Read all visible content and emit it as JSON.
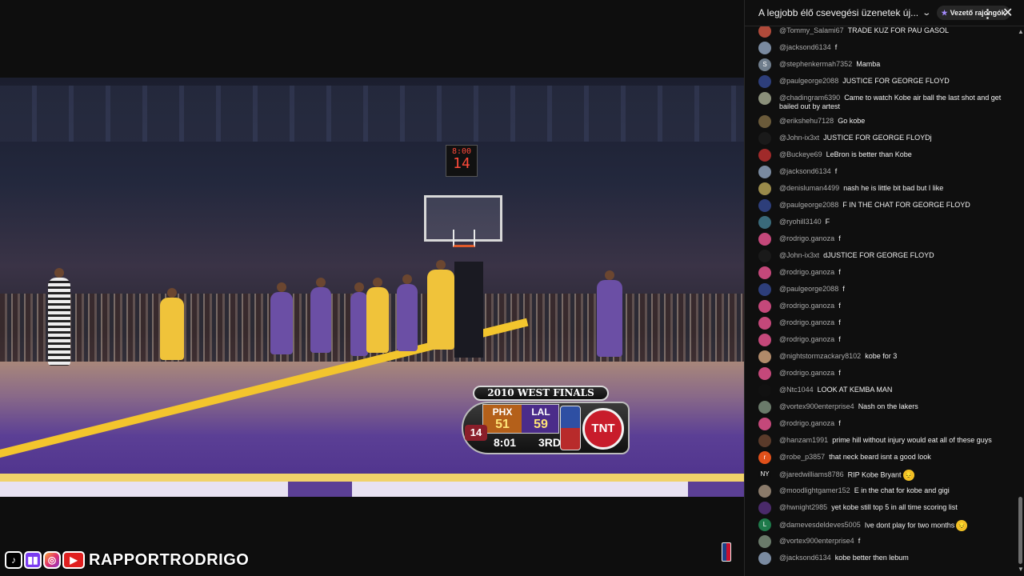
{
  "video": {
    "scoreboard": {
      "title": "2010 WEST FINALS",
      "away_team": "PHX",
      "away_score": "51",
      "home_team": "LAL",
      "home_score": "59",
      "shot_clock": "14",
      "game_clock": "8:01",
      "period": "3RD",
      "network": "TNT"
    },
    "arena_clock": {
      "time": "8:00",
      "shot": "14"
    },
    "watermark": {
      "channel": "RAPPORTRODRIGO",
      "icons": [
        "tiktok-icon",
        "twitch-icon",
        "instagram-icon",
        "youtube-icon"
      ]
    }
  },
  "chat": {
    "header": {
      "title": "A legjobb élő csevegési üzenetek új...",
      "fan_badge": "Vezető rajongók",
      "menu_icon": "more-vertical-icon",
      "close_icon": "close-icon"
    },
    "messages": [
      {
        "author": "@Tommy_Salami67",
        "text": "TRADE KUZ FOR PAU GASOL",
        "avatar_color": "#b04a3a",
        "avatar_letter": ""
      },
      {
        "author": "@jacksond6134",
        "text": "f",
        "avatar_color": "#7a8aa0",
        "avatar_letter": ""
      },
      {
        "author": "@stephenkermah7352",
        "text": "Mamba",
        "avatar_color": "#6f7d8c",
        "avatar_letter": "S"
      },
      {
        "author": "@paulgeorge2088",
        "text": "JUSTICE FOR GEORGE FLOYD",
        "avatar_color": "#2d3e7a",
        "avatar_letter": ""
      },
      {
        "author": "@chadingram6390",
        "text": "Came to watch Kobe air ball the last shot and get bailed out by artest",
        "avatar_color": "#8a8f7a",
        "avatar_letter": ""
      },
      {
        "author": "@erikshehu7128",
        "text": "Go kobe",
        "avatar_color": "#6a5a3a",
        "avatar_letter": ""
      },
      {
        "author": "@John-ix3xt",
        "text": "JUSTICE FOR GEORGE FLOYDj",
        "avatar_color": "#1a1a1a",
        "avatar_letter": ""
      },
      {
        "author": "@Buckeye69",
        "text": "LeBron is better than Kobe",
        "avatar_color": "#a02a2a",
        "avatar_letter": ""
      },
      {
        "author": "@jacksond6134",
        "text": "f",
        "avatar_color": "#7a8aa0",
        "avatar_letter": ""
      },
      {
        "author": "@denisluman4499",
        "text": "nash he is little bit bad but I like",
        "avatar_color": "#9a8a4a",
        "avatar_letter": ""
      },
      {
        "author": "@paulgeorge2088",
        "text": "F IN THE CHAT FOR GEORGE FLOYD",
        "avatar_color": "#2d3e7a",
        "avatar_letter": ""
      },
      {
        "author": "@ryohill3140",
        "text": "F",
        "avatar_color": "#3a6a7a",
        "avatar_letter": ""
      },
      {
        "author": "@rodrigo.ganoza",
        "text": "f",
        "avatar_color": "#c4487a",
        "avatar_letter": ""
      },
      {
        "author": "@John-ix3xt",
        "text": "dJUSTICE FOR GEORGE FLOYD",
        "avatar_color": "#1a1a1a",
        "avatar_letter": ""
      },
      {
        "author": "@rodrigo.ganoza",
        "text": "f",
        "avatar_color": "#c4487a",
        "avatar_letter": ""
      },
      {
        "author": "@paulgeorge2088",
        "text": "f",
        "avatar_color": "#2d3e7a",
        "avatar_letter": ""
      },
      {
        "author": "@rodrigo.ganoza",
        "text": "f",
        "avatar_color": "#c4487a",
        "avatar_letter": ""
      },
      {
        "author": "@rodrigo.ganoza",
        "text": "f",
        "avatar_color": "#c4487a",
        "avatar_letter": ""
      },
      {
        "author": "@rodrigo.ganoza",
        "text": "f",
        "avatar_color": "#c4487a",
        "avatar_letter": ""
      },
      {
        "author": "@nightstormzackary8102",
        "text": "kobe for 3",
        "avatar_color": "#b08a6a",
        "avatar_letter": ""
      },
      {
        "author": "@rodrigo.ganoza",
        "text": "f",
        "avatar_color": "#c4487a",
        "avatar_letter": ""
      },
      {
        "author": "@Ntc1044",
        "text": "LOOK AT KEMBA MAN",
        "avatar_color": "#111111",
        "avatar_letter": ""
      },
      {
        "author": "@vortex900enterprise4",
        "text": "Nash on the lakers",
        "avatar_color": "#6a7a6a",
        "avatar_letter": ""
      },
      {
        "author": "@rodrigo.ganoza",
        "text": "f",
        "avatar_color": "#c4487a",
        "avatar_letter": ""
      },
      {
        "author": "@hanzam1991",
        "text": "prime hill without injury would eat all of these guys",
        "avatar_color": "#5a3a2a",
        "avatar_letter": ""
      },
      {
        "author": "@robe_p3857",
        "text": "that neck beard isnt a good look",
        "avatar_color": "#e0501a",
        "avatar_letter": "r"
      },
      {
        "author": "@jaredwilliams8786",
        "text": "RIP Kobe Bryant",
        "avatar_color": "#0f0f0f",
        "avatar_letter": "NY",
        "emoji": "😔"
      },
      {
        "author": "@moodlightgamer152",
        "text": "E in the chat for kobe and gigi",
        "avatar_color": "#8a7a6a",
        "avatar_letter": ""
      },
      {
        "author": "@hwnight2985",
        "text": "yet kobe still top 5 in all time scoring list",
        "avatar_color": "#4a2a6a",
        "avatar_letter": ""
      },
      {
        "author": "@damevesdeldeves5005",
        "text": "Ive dont play for two months",
        "avatar_color": "#1e7a4a",
        "avatar_letter": "L",
        "emoji": "😔"
      },
      {
        "author": "@vortex900enterprise4",
        "text": "f",
        "avatar_color": "#6a7a6a",
        "avatar_letter": ""
      },
      {
        "author": "@jacksond6134",
        "text": "kobe better then lebum",
        "avatar_color": "#7a8aa0",
        "avatar_letter": ""
      }
    ]
  }
}
